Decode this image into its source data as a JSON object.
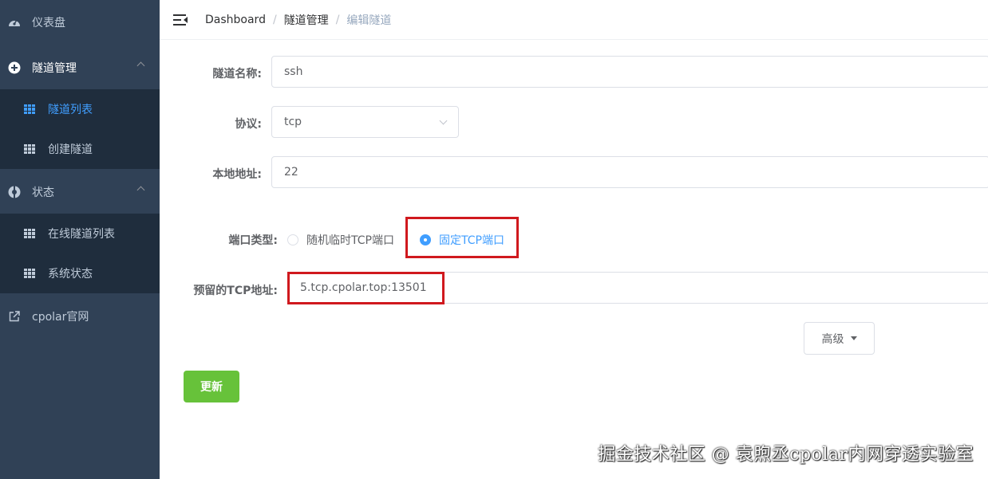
{
  "sidebar": {
    "dashboard": {
      "label": "仪表盘",
      "icon": "dashboard-gauge-icon"
    },
    "tunnel_mgmt": {
      "label": "隧道管理",
      "icon": "plus-circle-icon"
    },
    "tunnel_list": {
      "label": "隧道列表",
      "icon": "grid-icon"
    },
    "create_tunnel": {
      "label": "创建隧道",
      "icon": "grid-icon"
    },
    "status": {
      "label": "状态",
      "icon": "lifebuoy-icon"
    },
    "online_tunnels": {
      "label": "在线隧道列表",
      "icon": "grid-icon"
    },
    "system_status": {
      "label": "系统状态",
      "icon": "grid-icon"
    },
    "cpolar_site": {
      "label": "cpolar官网",
      "icon": "external-link-icon"
    }
  },
  "header": {
    "breadcrumb": [
      "Dashboard",
      "隧道管理",
      "编辑隧道"
    ],
    "separator": "/"
  },
  "form": {
    "name_label": "隧道名称:",
    "name_value": "ssh",
    "protocol_label": "协议:",
    "protocol_value": "tcp",
    "local_addr_label": "本地地址:",
    "local_addr_value": "22",
    "port_type_label": "端口类型:",
    "port_type_options": [
      "随机临时TCP端口",
      "固定TCP端口"
    ],
    "port_type_selected": "固定TCP端口",
    "reserved_addr_label": "预留的TCP地址:",
    "reserved_addr_value": "5.tcp.cpolar.top:13501",
    "advanced_label": "高级",
    "update_label": "更新"
  },
  "watermark": "掘金技术社区 @ 袁煦丞cpolar内网穿透实验室",
  "colors": {
    "sidebar_bg": "#304156",
    "submenu_bg": "#1f2d3d",
    "active": "#409eff",
    "update_button": "#67c23a",
    "highlight_box": "#d0191e"
  }
}
